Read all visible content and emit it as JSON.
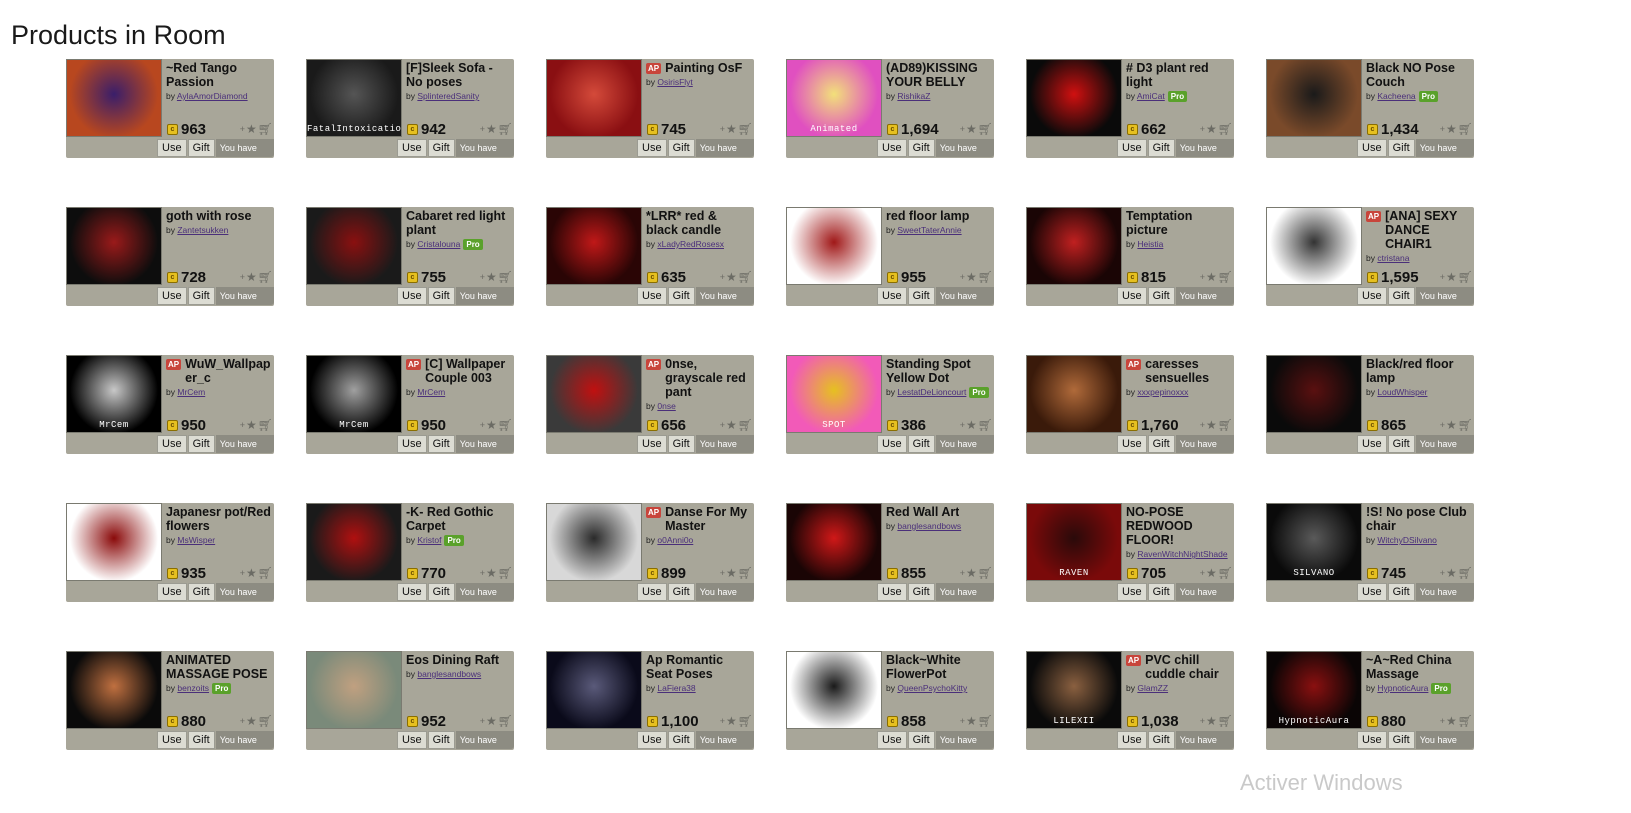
{
  "page": {
    "title": "Products in Room"
  },
  "labels": {
    "use": "Use",
    "gift": "Gift",
    "have": "You have this",
    "ap": "AP",
    "pro": "Pro",
    "by": "by"
  },
  "watermark": "Activer Windows",
  "products": [
    {
      "title": "~Red Tango Passion",
      "creator": "AylaAmorDiamond",
      "price": "963",
      "ap": false,
      "pro": false,
      "colors": [
        "#b8471f",
        "#3a1e6a"
      ],
      "thumb_text": ""
    },
    {
      "title": "[F]Sleek Sofa - No poses",
      "creator": "SplinteredSanity",
      "price": "942",
      "ap": false,
      "pro": false,
      "colors": [
        "#1a1a1a",
        "#555555"
      ],
      "thumb_text": "FatalIntoxication"
    },
    {
      "title": "Painting OsF",
      "creator": "OsirisFlyt",
      "price": "745",
      "ap": true,
      "pro": false,
      "colors": [
        "#8a0f12",
        "#d44a3a"
      ],
      "thumb_text": ""
    },
    {
      "title": "(AD89)KISSING YOUR BELLY",
      "creator": "RishikaZ",
      "price": "1,694",
      "ap": false,
      "pro": false,
      "colors": [
        "#e050c0",
        "#f2e07a"
      ],
      "thumb_text": "Animated"
    },
    {
      "title": "# D3 plant red light",
      "creator": "AmiCat",
      "price": "662",
      "ap": false,
      "pro": true,
      "colors": [
        "#0a0a0a",
        "#d01010"
      ],
      "thumb_text": ""
    },
    {
      "title": "Black NO Pose Couch",
      "creator": "Kacheena",
      "price": "1,434",
      "ap": false,
      "pro": true,
      "colors": [
        "#7a4a2a",
        "#1a1a1a"
      ],
      "thumb_text": ""
    },
    {
      "title": "goth with rose",
      "creator": "Zantetsukken",
      "price": "728",
      "ap": false,
      "pro": false,
      "colors": [
        "#0d0d0d",
        "#9a1a1a"
      ],
      "thumb_text": ""
    },
    {
      "title": "Cabaret red light plant",
      "creator": "Cristalouna",
      "price": "755",
      "ap": false,
      "pro": true,
      "colors": [
        "#1a1a1a",
        "#8a1010"
      ],
      "thumb_text": ""
    },
    {
      "title": "*LRR* red & black candle",
      "creator": "xLadyRedRosesx",
      "price": "635",
      "ap": false,
      "pro": false,
      "colors": [
        "#2a0505",
        "#c01818"
      ],
      "thumb_text": ""
    },
    {
      "title": "red floor lamp",
      "creator": "SweetTaterAnnie",
      "price": "955",
      "ap": false,
      "pro": false,
      "colors": [
        "#ffffff",
        "#a01818"
      ],
      "thumb_text": ""
    },
    {
      "title": "Temptation picture",
      "creator": "Heistia",
      "price": "815",
      "ap": false,
      "pro": false,
      "colors": [
        "#1a0505",
        "#c02020"
      ],
      "thumb_text": ""
    },
    {
      "title": "[ANA] SEXY DANCE CHAIR1",
      "creator": "ctristana",
      "price": "1,595",
      "ap": true,
      "pro": false,
      "colors": [
        "#ffffff",
        "#333333"
      ],
      "thumb_text": ""
    },
    {
      "title": "WuW_Wallpaper_c",
      "creator": "MrCem",
      "price": "950",
      "ap": true,
      "pro": false,
      "colors": [
        "#000000",
        "#c8c8c8"
      ],
      "thumb_text": "MrCem"
    },
    {
      "title": "[C] Wallpaper Couple 003",
      "creator": "MrCem",
      "price": "950",
      "ap": true,
      "pro": false,
      "colors": [
        "#000000",
        "#a0a0a0"
      ],
      "thumb_text": "MrCem"
    },
    {
      "title": "0nse, grayscale red pant",
      "creator": "0nse",
      "price": "656",
      "ap": true,
      "pro": false,
      "colors": [
        "#3a3a3a",
        "#c01010"
      ],
      "thumb_text": ""
    },
    {
      "title": "Standing Spot Yellow Dot",
      "creator": "LestatDeLioncourt",
      "price": "386",
      "ap": false,
      "pro": true,
      "colors": [
        "#f25ab8",
        "#e6c020"
      ],
      "thumb_text": "SPOT"
    },
    {
      "title": "caresses sensuelles",
      "creator": "xxxpepinoxxx",
      "price": "1,760",
      "ap": true,
      "pro": false,
      "colors": [
        "#3a1a0a",
        "#b06a3a"
      ],
      "thumb_text": ""
    },
    {
      "title": "Black/red floor lamp",
      "creator": "LoudWhisper",
      "price": "865",
      "ap": false,
      "pro": false,
      "colors": [
        "#0a0a0a",
        "#5a1010"
      ],
      "thumb_text": ""
    },
    {
      "title": "Japanesr pot/Red flowers",
      "creator": "MsWisper",
      "price": "935",
      "ap": false,
      "pro": false,
      "colors": [
        "#ffffff",
        "#8a0a0a"
      ],
      "thumb_text": ""
    },
    {
      "title": "-K- Red Gothic Carpet",
      "creator": "Kristof",
      "price": "770",
      "ap": false,
      "pro": true,
      "colors": [
        "#1a1a1a",
        "#b01010"
      ],
      "thumb_text": ""
    },
    {
      "title": "Danse For My Master",
      "creator": "o0Anni0o",
      "price": "899",
      "ap": true,
      "pro": false,
      "colors": [
        "#d8d8d8",
        "#2a2a2a"
      ],
      "thumb_text": ""
    },
    {
      "title": "Red Wall Art",
      "creator": "banglesandbows",
      "price": "855",
      "ap": false,
      "pro": false,
      "colors": [
        "#1a0505",
        "#d01818"
      ],
      "thumb_text": ""
    },
    {
      "title": "NO-POSE REDWOOD FLOOR!",
      "creator": "RavenWitchNightShade",
      "price": "705",
      "ap": false,
      "pro": false,
      "colors": [
        "#7a0a0a",
        "#2a0a0a"
      ],
      "thumb_text": "RAVEN"
    },
    {
      "title": "!S! No pose Club chair",
      "creator": "WitchyDSilvano",
      "price": "745",
      "ap": false,
      "pro": false,
      "colors": [
        "#0a0a0a",
        "#5a5a5a"
      ],
      "thumb_text": "SILVANO"
    },
    {
      "title": "ANIMATED MASSAGE POSE",
      "creator": "benzoits",
      "price": "880",
      "ap": false,
      "pro": true,
      "colors": [
        "#0a0a0a",
        "#c07040"
      ],
      "thumb_text": ""
    },
    {
      "title": "Eos Dining Raft",
      "creator": "banglesandbows",
      "price": "952",
      "ap": false,
      "pro": false,
      "colors": [
        "#7a8a7a",
        "#c0a080"
      ],
      "thumb_text": ""
    },
    {
      "title": "Ap Romantic Seat Poses",
      "creator": "LaFiera38",
      "price": "1,100",
      "ap": false,
      "pro": false,
      "colors": [
        "#0a0a1a",
        "#5a5a7a"
      ],
      "thumb_text": ""
    },
    {
      "title": "Black~White FlowerPot",
      "creator": "QueenPsychoKitty",
      "price": "858",
      "ap": false,
      "pro": false,
      "colors": [
        "#ffffff",
        "#1a1a1a"
      ],
      "thumb_text": ""
    },
    {
      "title": "PVC chill cuddle chair",
      "creator": "GlamZZ",
      "price": "1,038",
      "ap": true,
      "pro": false,
      "colors": [
        "#0a0a0a",
        "#8a6040"
      ],
      "thumb_text": "LILEXII"
    },
    {
      "title": "~A~Red China Massage",
      "creator": "HypnoticAura",
      "price": "880",
      "ap": false,
      "pro": true,
      "colors": [
        "#0a0505",
        "#8a1010"
      ],
      "thumb_text": "HypnoticAura"
    }
  ]
}
